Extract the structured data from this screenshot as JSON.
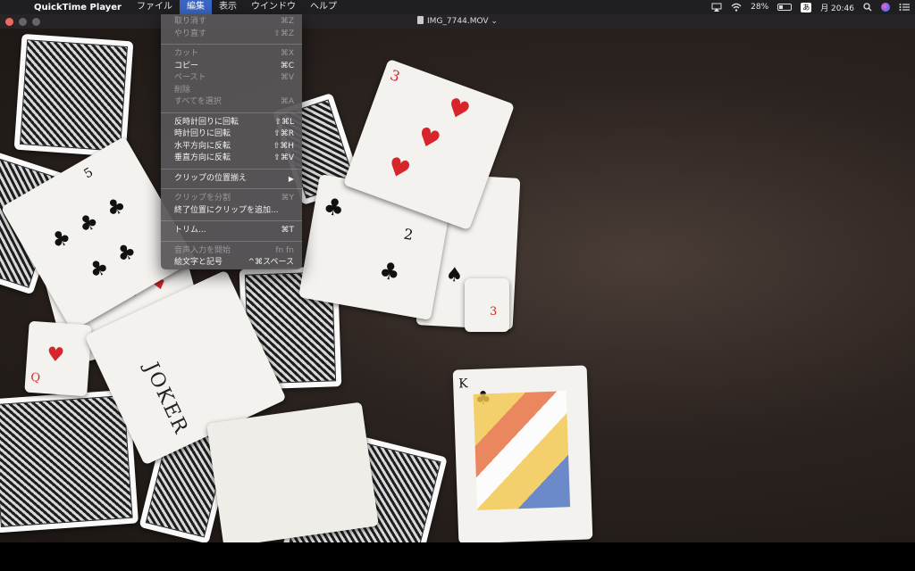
{
  "menubar": {
    "apple_icon": "",
    "app_name": "QuickTime Player",
    "menus": [
      "ファイル",
      "編集",
      "表示",
      "ウインドウ",
      "ヘルプ"
    ],
    "active_menu": "編集",
    "status": {
      "battery_percent": "28%",
      "ime": "あ",
      "clock": "月 20:46"
    }
  },
  "window": {
    "title": "IMG_7744.MOV",
    "title_chevron": "⌄"
  },
  "edit_menu": {
    "items": [
      {
        "label": "取り消す",
        "shortcut": "⌘Z",
        "enabled": false
      },
      {
        "label": "やり直す",
        "shortcut": "⇧⌘Z",
        "enabled": false
      },
      {
        "label": "カット",
        "shortcut": "⌘X",
        "enabled": false
      },
      {
        "label": "コピー",
        "shortcut": "⌘C",
        "enabled": true
      },
      {
        "label": "ペースト",
        "shortcut": "⌘V",
        "enabled": false
      },
      {
        "label": "削除",
        "shortcut": "",
        "enabled": false
      },
      {
        "label": "すべてを選択",
        "shortcut": "⌘A",
        "enabled": false
      },
      {
        "label": "反時計回りに回転",
        "shortcut": "⇧⌘L",
        "enabled": true
      },
      {
        "label": "時計回りに回転",
        "shortcut": "⇧⌘R",
        "enabled": true
      },
      {
        "label": "水平方向に反転",
        "shortcut": "⇧⌘H",
        "enabled": true
      },
      {
        "label": "垂直方向に反転",
        "shortcut": "⇧⌘V",
        "enabled": true
      },
      {
        "label": "クリップの位置揃え",
        "shortcut": "▶",
        "enabled": true
      },
      {
        "label": "クリップを分割",
        "shortcut": "⌘Y",
        "enabled": false
      },
      {
        "label": "終了位置にクリップを追加...",
        "shortcut": "",
        "enabled": true
      },
      {
        "label": "トリム...",
        "shortcut": "⌘T",
        "enabled": true
      },
      {
        "label": "音声入力を開始",
        "shortcut": "fn fn",
        "enabled": false
      },
      {
        "label": "絵文字と記号",
        "shortcut": "^⌘スペース",
        "enabled": true
      }
    ]
  },
  "video": {
    "cards": {
      "three_hearts": "3",
      "five_clubs": "5",
      "two_clubs": "2",
      "five_spades": "5",
      "three_diamonds": "3",
      "joker": "JOKER",
      "king_clubs": "K",
      "queen_hearts": "Q"
    }
  }
}
